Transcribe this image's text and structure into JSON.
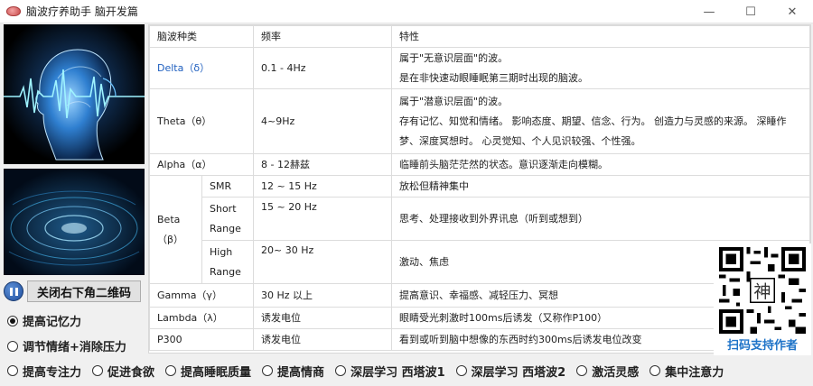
{
  "window": {
    "title": "脑波疗养助手 脑开发篇",
    "min_glyph": "—",
    "max_glyph": "☐",
    "close_glyph": "✕"
  },
  "left": {
    "close_qr_label": "关闭右下角二维码",
    "modes": [
      {
        "label": "提高记忆力",
        "checked": true
      },
      {
        "label": "调节情绪+消除压力",
        "checked": false
      }
    ]
  },
  "table": {
    "headers": {
      "type": "脑波种类",
      "freq": "频率",
      "prop": "特性"
    },
    "delta": {
      "type": "Delta（δ）",
      "freq": "0.1 - 4Hz",
      "prop": [
        "属于\"无意识层面\"的波。",
        "是在非快速动眼睡眠第三期时出现的脑波。"
      ]
    },
    "theta": {
      "type": "Theta（θ）",
      "freq": "4~9Hz",
      "prop": [
        "属于\"潜意识层面\"的波。",
        "存有记忆、知觉和情绪。 影响态度、期望、信念、行为。 创造力与灵感的来源。 深睡作",
        "梦、深度冥想时。 心灵觉知、个人见识较强、个性强。"
      ]
    },
    "alpha": {
      "type": "Alpha（α）",
      "freq": "8 - 12赫兹",
      "prop": "临睡前头脑茫茫然的状态。意识逐渐走向模糊。"
    },
    "beta": {
      "type": [
        "Beta",
        "（β）"
      ],
      "smr": {
        "sub": "SMR",
        "freq": "12 ~ 15 Hz",
        "prop": "放松但精神集中"
      },
      "short": {
        "sub": [
          "Short",
          "Range"
        ],
        "freq": "15 ~ 20 Hz",
        "prop": "思考、处理接收到外界讯息（听到或想到）"
      },
      "high": {
        "sub": [
          "High",
          "Range"
        ],
        "freq": "20~ 30 Hz",
        "prop": "激动、焦虑"
      }
    },
    "gamma": {
      "type": "Gamma（γ）",
      "freq": "30 Hz 以上",
      "prop": "提高意识、幸福感、减轻压力、冥想"
    },
    "lambda": {
      "type": "Lambda（λ）",
      "freq": "诱发电位",
      "prop": "眼睛受光刺激时100ms后诱发（又称作P100）"
    },
    "p300": {
      "type": "P300",
      "freq": "诱发电位",
      "prop": "看到或听到脑中想像的东西时约300ms后诱发电位改变"
    }
  },
  "qr": {
    "caption": "扫码支持作者",
    "center_char": "神"
  },
  "bottom_options": [
    {
      "label": "提高专注力",
      "checked": false
    },
    {
      "label": "促进食欲",
      "checked": false
    },
    {
      "label": "提高睡眠质量",
      "checked": false
    },
    {
      "label": "提高情商",
      "checked": false
    },
    {
      "label": "深层学习 西塔波1",
      "checked": false
    },
    {
      "label": "深层学习 西塔波2",
      "checked": false
    },
    {
      "label": "激活灵感",
      "checked": false
    },
    {
      "label": "集中注意力",
      "checked": false
    }
  ],
  "colors": {
    "accent": "#1e73c8",
    "link": "#1f5fbf"
  }
}
